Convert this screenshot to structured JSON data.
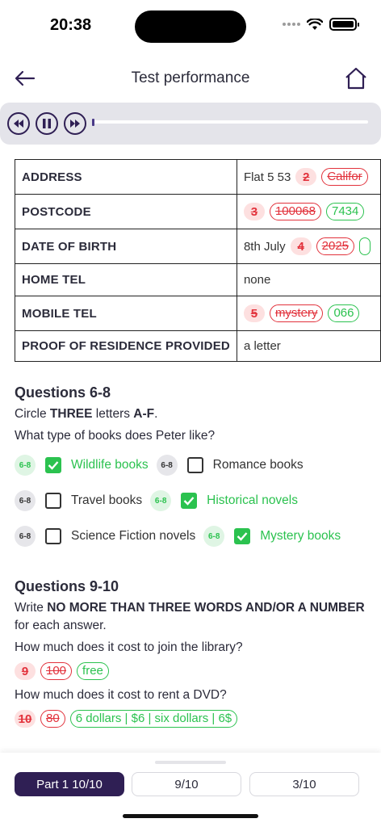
{
  "status": {
    "time": "20:38"
  },
  "header": {
    "title": "Test performance"
  },
  "form": {
    "rows": [
      {
        "label": "ADDRESS",
        "value": "Flat 5 53",
        "num": "2",
        "wrong": "Califor",
        "correct": ""
      },
      {
        "label": "POSTCODE",
        "value": "",
        "num": "3",
        "wrong": "100068",
        "correct": "7434"
      },
      {
        "label": "DATE OF BIRTH",
        "value": "8th July",
        "num": "4",
        "wrong": "2025",
        "correct": " "
      },
      {
        "label": "HOME TEL",
        "value": "none",
        "num": "",
        "wrong": "",
        "correct": ""
      },
      {
        "label": "MOBILE TEL",
        "value": "",
        "num": "5",
        "wrong": "mystery",
        "correct": "066"
      },
      {
        "label": "PROOF OF RESIDENCE PROVIDED",
        "value": "a letter",
        "num": "",
        "wrong": "",
        "correct": ""
      }
    ]
  },
  "q1": {
    "heading": "Questions 6-8",
    "instruction_pre": "Circle ",
    "instruction_b1": "THREE",
    "instruction_mid": " letters ",
    "instruction_b2": "A-F",
    "instruction_post": ".",
    "question": "What type of books does Peter like?",
    "badge": "6-8",
    "options": [
      {
        "label": "Wildlife books",
        "checked": true
      },
      {
        "label": "Romance books",
        "checked": false
      },
      {
        "label": "Travel books",
        "checked": false
      },
      {
        "label": "Historical novels",
        "checked": true
      },
      {
        "label": "Science Fiction novels",
        "checked": false
      },
      {
        "label": "Mystery books",
        "checked": true
      }
    ]
  },
  "q2": {
    "heading": "Questions 9-10",
    "instruction_pre": "Write ",
    "instruction_b1": "NO MORE THAN THREE WORDS AND/OR A NUMBER",
    "instruction_post": " for each answer.",
    "items": [
      {
        "question": "How much does it cost to join the library?",
        "num": "9",
        "wrong": "100",
        "correct": "free"
      },
      {
        "question": "How much does it cost to rent a DVD?",
        "num": "10",
        "wrong": "80",
        "correct": "6 dollars | $6 | six dollars | 6$"
      }
    ]
  },
  "tabs": [
    {
      "label": "Part 1 10/10",
      "active": true
    },
    {
      "label": "9/10",
      "active": false
    },
    {
      "label": "3/10",
      "active": false
    }
  ],
  "colors": {
    "accent": "#2f1f54",
    "correct": "#2bc24f",
    "wrong": "#e2323c"
  }
}
